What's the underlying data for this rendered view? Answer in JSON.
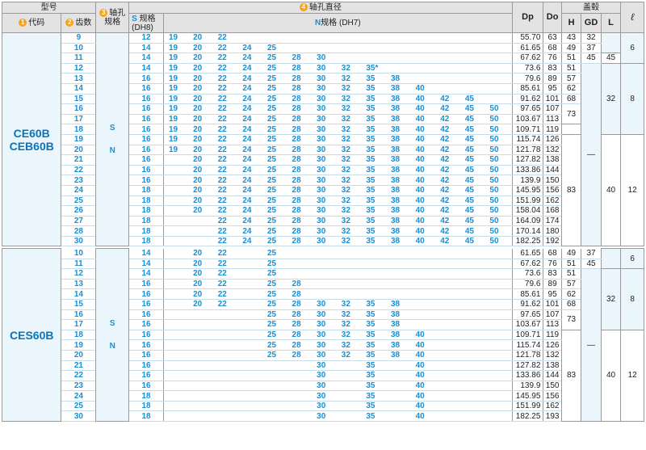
{
  "header": {
    "model": "型号",
    "code_num": "1",
    "code": "代码",
    "teeth_num": "2",
    "teeth": "齿数",
    "shaft_num": "3",
    "shaft_hole": "轴孔",
    "spec": "规格",
    "bore_num": "4",
    "bore_dia": "轴孔直径",
    "s_letter": "S",
    "s_spec": "规格",
    "dh8": "(DH8)",
    "n_letter": "N",
    "n_spec": "规格",
    "dh7": "(DH7)",
    "dp": "Dp",
    "do": "Do",
    "cover": "盖毂",
    "h": "H",
    "gd": "GD",
    "l": "L",
    "ell": "ℓ",
    "s_mark": "S",
    "n_mark": "N",
    "dash": "—"
  },
  "groups": [
    {
      "code_line1": "CE60B",
      "code_line2": "CEB60B",
      "rows": [
        {
          "z": "9",
          "s": "12",
          "n": [
            "19",
            "20",
            "22",
            "",
            "",
            "",
            "",
            "",
            "",
            "",
            "",
            "",
            "",
            ""
          ],
          "dp": "55.70",
          "do": "63",
          "h": "43",
          "gd": "32"
        },
        {
          "z": "10",
          "s": "14",
          "n": [
            "19",
            "20",
            "22",
            "24",
            "25",
            "",
            "",
            "",
            "",
            "",
            "",
            "",
            "",
            ""
          ],
          "dp": "61.65",
          "do": "68",
          "h": "49",
          "gd": "37"
        },
        {
          "z": "11",
          "s": "14",
          "n": [
            "19",
            "20",
            "22",
            "24",
            "25",
            "28",
            "30",
            "",
            "",
            "",
            "",
            "",
            "",
            ""
          ],
          "dp": "67.62",
          "do": "76",
          "h": "51",
          "gd": "45"
        },
        {
          "z": "12",
          "s": "14",
          "n": [
            "19",
            "20",
            "22",
            "24",
            "25",
            "28",
            "30",
            "32",
            "35*",
            "",
            "",
            "",
            "",
            ""
          ],
          "dp": "73.6",
          "do": "83",
          "h": "51"
        },
        {
          "z": "13",
          "s": "16",
          "n": [
            "19",
            "20",
            "22",
            "24",
            "25",
            "28",
            "30",
            "32",
            "35",
            "38",
            "",
            "",
            "",
            ""
          ],
          "dp": "79.6",
          "do": "89",
          "h": "57"
        },
        {
          "z": "14",
          "s": "16",
          "n": [
            "19",
            "20",
            "22",
            "24",
            "25",
            "28",
            "30",
            "32",
            "35",
            "38",
            "40",
            "",
            "",
            ""
          ],
          "dp": "85.61",
          "do": "95",
          "h": "62"
        },
        {
          "z": "15",
          "s": "16",
          "n": [
            "19",
            "20",
            "22",
            "24",
            "25",
            "28",
            "30",
            "32",
            "35",
            "38",
            "40",
            "42",
            "45",
            ""
          ],
          "dp": "91.62",
          "do": "101",
          "h": "68"
        },
        {
          "z": "16",
          "s": "16",
          "n": [
            "19",
            "20",
            "22",
            "24",
            "25",
            "28",
            "30",
            "32",
            "35",
            "38",
            "40",
            "42",
            "45",
            "50"
          ],
          "dp": "97.65",
          "do": "107"
        },
        {
          "z": "17",
          "s": "16",
          "n": [
            "19",
            "20",
            "22",
            "24",
            "25",
            "28",
            "30",
            "32",
            "35",
            "38",
            "40",
            "42",
            "45",
            "50"
          ],
          "dp": "103.67",
          "do": "113"
        },
        {
          "z": "18",
          "s": "16",
          "n": [
            "19",
            "20",
            "22",
            "24",
            "25",
            "28",
            "30",
            "32",
            "35",
            "38",
            "40",
            "42",
            "45",
            "50"
          ],
          "dp": "109.71",
          "do": "119"
        },
        {
          "z": "19",
          "s": "16",
          "n": [
            "19",
            "20",
            "22",
            "24",
            "25",
            "28",
            "30",
            "32",
            "35",
            "38",
            "40",
            "42",
            "45",
            "50"
          ],
          "dp": "115.74",
          "do": "126"
        },
        {
          "z": "20",
          "s": "16",
          "n": [
            "19",
            "20",
            "22",
            "24",
            "25",
            "28",
            "30",
            "32",
            "35",
            "38",
            "40",
            "42",
            "45",
            "50"
          ],
          "dp": "121.78",
          "do": "132"
        },
        {
          "z": "21",
          "s": "16",
          "n": [
            "",
            "20",
            "22",
            "24",
            "25",
            "28",
            "30",
            "32",
            "35",
            "38",
            "40",
            "42",
            "45",
            "50"
          ],
          "dp": "127.82",
          "do": "138"
        },
        {
          "z": "22",
          "s": "16",
          "n": [
            "",
            "20",
            "22",
            "24",
            "25",
            "28",
            "30",
            "32",
            "35",
            "38",
            "40",
            "42",
            "45",
            "50"
          ],
          "dp": "133.86",
          "do": "144"
        },
        {
          "z": "23",
          "s": "16",
          "n": [
            "",
            "20",
            "22",
            "24",
            "25",
            "28",
            "30",
            "32",
            "35",
            "38",
            "40",
            "42",
            "45",
            "50"
          ],
          "dp": "139.9",
          "do": "150"
        },
        {
          "z": "24",
          "s": "18",
          "n": [
            "",
            "20",
            "22",
            "24",
            "25",
            "28",
            "30",
            "32",
            "35",
            "38",
            "40",
            "42",
            "45",
            "50"
          ],
          "dp": "145.95",
          "do": "156"
        },
        {
          "z": "25",
          "s": "18",
          "n": [
            "",
            "20",
            "22",
            "24",
            "25",
            "28",
            "30",
            "32",
            "35",
            "38",
            "40",
            "42",
            "45",
            "50"
          ],
          "dp": "151.99",
          "do": "162"
        },
        {
          "z": "26",
          "s": "18",
          "n": [
            "",
            "20",
            "22",
            "24",
            "25",
            "28",
            "30",
            "32",
            "35",
            "38",
            "40",
            "42",
            "45",
            "50"
          ],
          "dp": "158.04",
          "do": "168"
        },
        {
          "z": "27",
          "s": "18",
          "n": [
            "",
            "",
            "22",
            "24",
            "25",
            "28",
            "30",
            "32",
            "35",
            "38",
            "40",
            "42",
            "45",
            "50"
          ],
          "dp": "164.09",
          "do": "174"
        },
        {
          "z": "28",
          "s": "18",
          "n": [
            "",
            "",
            "22",
            "24",
            "25",
            "28",
            "30",
            "32",
            "35",
            "38",
            "40",
            "42",
            "45",
            "50"
          ],
          "dp": "170.14",
          "do": "180"
        },
        {
          "z": "30",
          "s": "18",
          "n": [
            "",
            "",
            "22",
            "24",
            "25",
            "28",
            "30",
            "32",
            "35",
            "38",
            "40",
            "42",
            "45",
            "50"
          ],
          "dp": "182.25",
          "do": "192"
        }
      ],
      "merged": {
        "h73": "73",
        "h83": "83",
        "l32": "32",
        "l40": "40",
        "ell6": "6",
        "ell8": "8",
        "ell12": "12",
        "l45": "45"
      }
    },
    {
      "code_line1": "CES60B",
      "rows": [
        {
          "z": "10",
          "s": "14",
          "n": [
            "",
            "20",
            "22",
            "",
            "25",
            "",
            "",
            "",
            "",
            "",
            "",
            "",
            "",
            ""
          ],
          "dp": "61.65",
          "do": "68",
          "h": "49",
          "gd": "37"
        },
        {
          "z": "11",
          "s": "14",
          "n": [
            "",
            "20",
            "22",
            "",
            "25",
            "",
            "",
            "",
            "",
            "",
            "",
            "",
            "",
            ""
          ],
          "dp": "67.62",
          "do": "76",
          "h": "51",
          "gd": "45"
        },
        {
          "z": "12",
          "s": "14",
          "n": [
            "",
            "20",
            "22",
            "",
            "25",
            "",
            "",
            "",
            "",
            "",
            "",
            "",
            "",
            ""
          ],
          "dp": "73.6",
          "do": "83",
          "h": "51"
        },
        {
          "z": "13",
          "s": "16",
          "n": [
            "",
            "20",
            "22",
            "",
            "25",
            "28",
            "",
            "",
            "",
            "",
            "",
            "",
            "",
            ""
          ],
          "dp": "79.6",
          "do": "89",
          "h": "57"
        },
        {
          "z": "14",
          "s": "16",
          "n": [
            "",
            "20",
            "22",
            "",
            "25",
            "28",
            "",
            "",
            "",
            "",
            "",
            "",
            "",
            ""
          ],
          "dp": "85.61",
          "do": "95",
          "h": "62"
        },
        {
          "z": "15",
          "s": "16",
          "n": [
            "",
            "20",
            "22",
            "",
            "25",
            "28",
            "30",
            "32",
            "35",
            "38",
            "",
            "",
            "",
            ""
          ],
          "dp": "91.62",
          "do": "101",
          "h": "68"
        },
        {
          "z": "16",
          "s": "16",
          "n": [
            "",
            "",
            "",
            "",
            "25",
            "28",
            "30",
            "32",
            "35",
            "38",
            "",
            "",
            "",
            ""
          ],
          "dp": "97.65",
          "do": "107"
        },
        {
          "z": "17",
          "s": "16",
          "n": [
            "",
            "",
            "",
            "",
            "25",
            "28",
            "30",
            "32",
            "35",
            "38",
            "",
            "",
            "",
            ""
          ],
          "dp": "103.67",
          "do": "113"
        },
        {
          "z": "18",
          "s": "16",
          "n": [
            "",
            "",
            "",
            "",
            "25",
            "28",
            "30",
            "32",
            "35",
            "38",
            "40",
            "",
            "",
            ""
          ],
          "dp": "109.71",
          "do": "119"
        },
        {
          "z": "19",
          "s": "16",
          "n": [
            "",
            "",
            "",
            "",
            "25",
            "28",
            "30",
            "32",
            "35",
            "38",
            "40",
            "",
            "",
            ""
          ],
          "dp": "115.74",
          "do": "126"
        },
        {
          "z": "20",
          "s": "16",
          "n": [
            "",
            "",
            "",
            "",
            "25",
            "28",
            "30",
            "32",
            "35",
            "38",
            "40",
            "",
            "",
            ""
          ],
          "dp": "121.78",
          "do": "132"
        },
        {
          "z": "21",
          "s": "16",
          "n": [
            "",
            "",
            "",
            "",
            "",
            "",
            "30",
            "",
            "35",
            "",
            "40",
            "",
            "",
            ""
          ],
          "dp": "127.82",
          "do": "138"
        },
        {
          "z": "22",
          "s": "16",
          "n": [
            "",
            "",
            "",
            "",
            "",
            "",
            "30",
            "",
            "35",
            "",
            "40",
            "",
            "",
            ""
          ],
          "dp": "133.86",
          "do": "144"
        },
        {
          "z": "23",
          "s": "16",
          "n": [
            "",
            "",
            "",
            "",
            "",
            "",
            "30",
            "",
            "35",
            "",
            "40",
            "",
            "",
            ""
          ],
          "dp": "139.9",
          "do": "150"
        },
        {
          "z": "24",
          "s": "18",
          "n": [
            "",
            "",
            "",
            "",
            "",
            "",
            "30",
            "",
            "35",
            "",
            "40",
            "",
            "",
            ""
          ],
          "dp": "145.95",
          "do": "156"
        },
        {
          "z": "25",
          "s": "18",
          "n": [
            "",
            "",
            "",
            "",
            "",
            "",
            "30",
            "",
            "35",
            "",
            "40",
            "",
            "",
            ""
          ],
          "dp": "151.99",
          "do": "162"
        },
        {
          "z": "30",
          "s": "18",
          "n": [
            "",
            "",
            "",
            "",
            "",
            "",
            "30",
            "",
            "35",
            "",
            "40",
            "",
            "",
            ""
          ],
          "dp": "182.25",
          "do": "193"
        }
      ],
      "merged": {
        "h73": "73",
        "h83": "83",
        "l32": "32",
        "l40": "40",
        "ell6": "6",
        "ell8": "8",
        "ell12": "12"
      }
    }
  ],
  "colors": {
    "accent": "#1a8fd2",
    "code": "#0a74b9",
    "badge": "#f7a21b",
    "header_bg": "#e3e3e3",
    "light_bg": "#eaf6fb"
  }
}
